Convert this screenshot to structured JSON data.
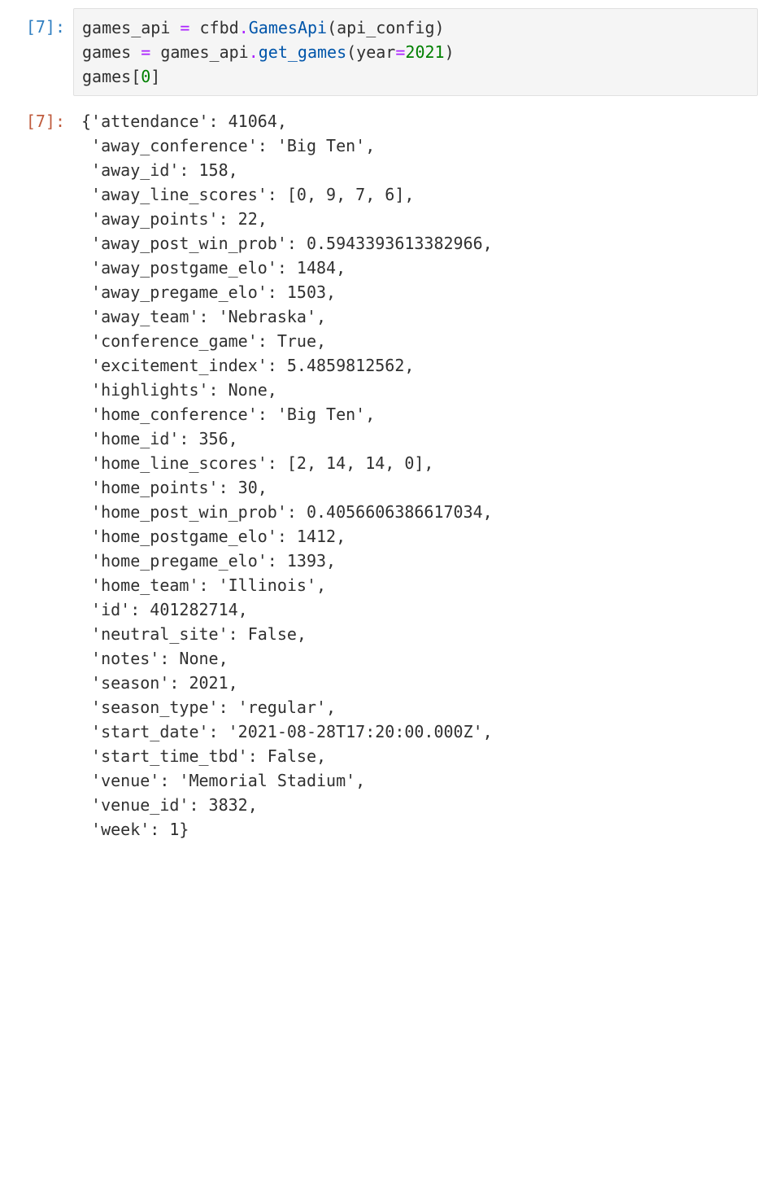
{
  "prompts": {
    "in": "[7]:",
    "out": "[7]:"
  },
  "code": {
    "l1_a": "games_api ",
    "l1_eq": "=",
    "l1_b": " cfbd",
    "l1_dot1": ".",
    "l1_c": "GamesApi",
    "l1_d": "(api_config)",
    "l2_a": "games ",
    "l2_eq": "=",
    "l2_b": " games_api",
    "l2_dot1": ".",
    "l2_c": "get_games",
    "l2_d": "(year",
    "l2_eq2": "=",
    "l2_e": "2021",
    "l2_f": ")",
    "l3_a": "games[",
    "l3_b": "0",
    "l3_c": "]"
  },
  "output_lines": [
    "{'attendance': 41064,",
    " 'away_conference': 'Big Ten',",
    " 'away_id': 158,",
    " 'away_line_scores': [0, 9, 7, 6],",
    " 'away_points': 22,",
    " 'away_post_win_prob': 0.5943393613382966,",
    " 'away_postgame_elo': 1484,",
    " 'away_pregame_elo': 1503,",
    " 'away_team': 'Nebraska',",
    " 'conference_game': True,",
    " 'excitement_index': 5.4859812562,",
    " 'highlights': None,",
    " 'home_conference': 'Big Ten',",
    " 'home_id': 356,",
    " 'home_line_scores': [2, 14, 14, 0],",
    " 'home_points': 30,",
    " 'home_post_win_prob': 0.4056606386617034,",
    " 'home_postgame_elo': 1412,",
    " 'home_pregame_elo': 1393,",
    " 'home_team': 'Illinois',",
    " 'id': 401282714,",
    " 'neutral_site': False,",
    " 'notes': None,",
    " 'season': 2021,",
    " 'season_type': 'regular',",
    " 'start_date': '2021-08-28T17:20:00.000Z',",
    " 'start_time_tbd': False,",
    " 'venue': 'Memorial Stadium',",
    " 'venue_id': 3832,",
    " 'week': 1}"
  ]
}
